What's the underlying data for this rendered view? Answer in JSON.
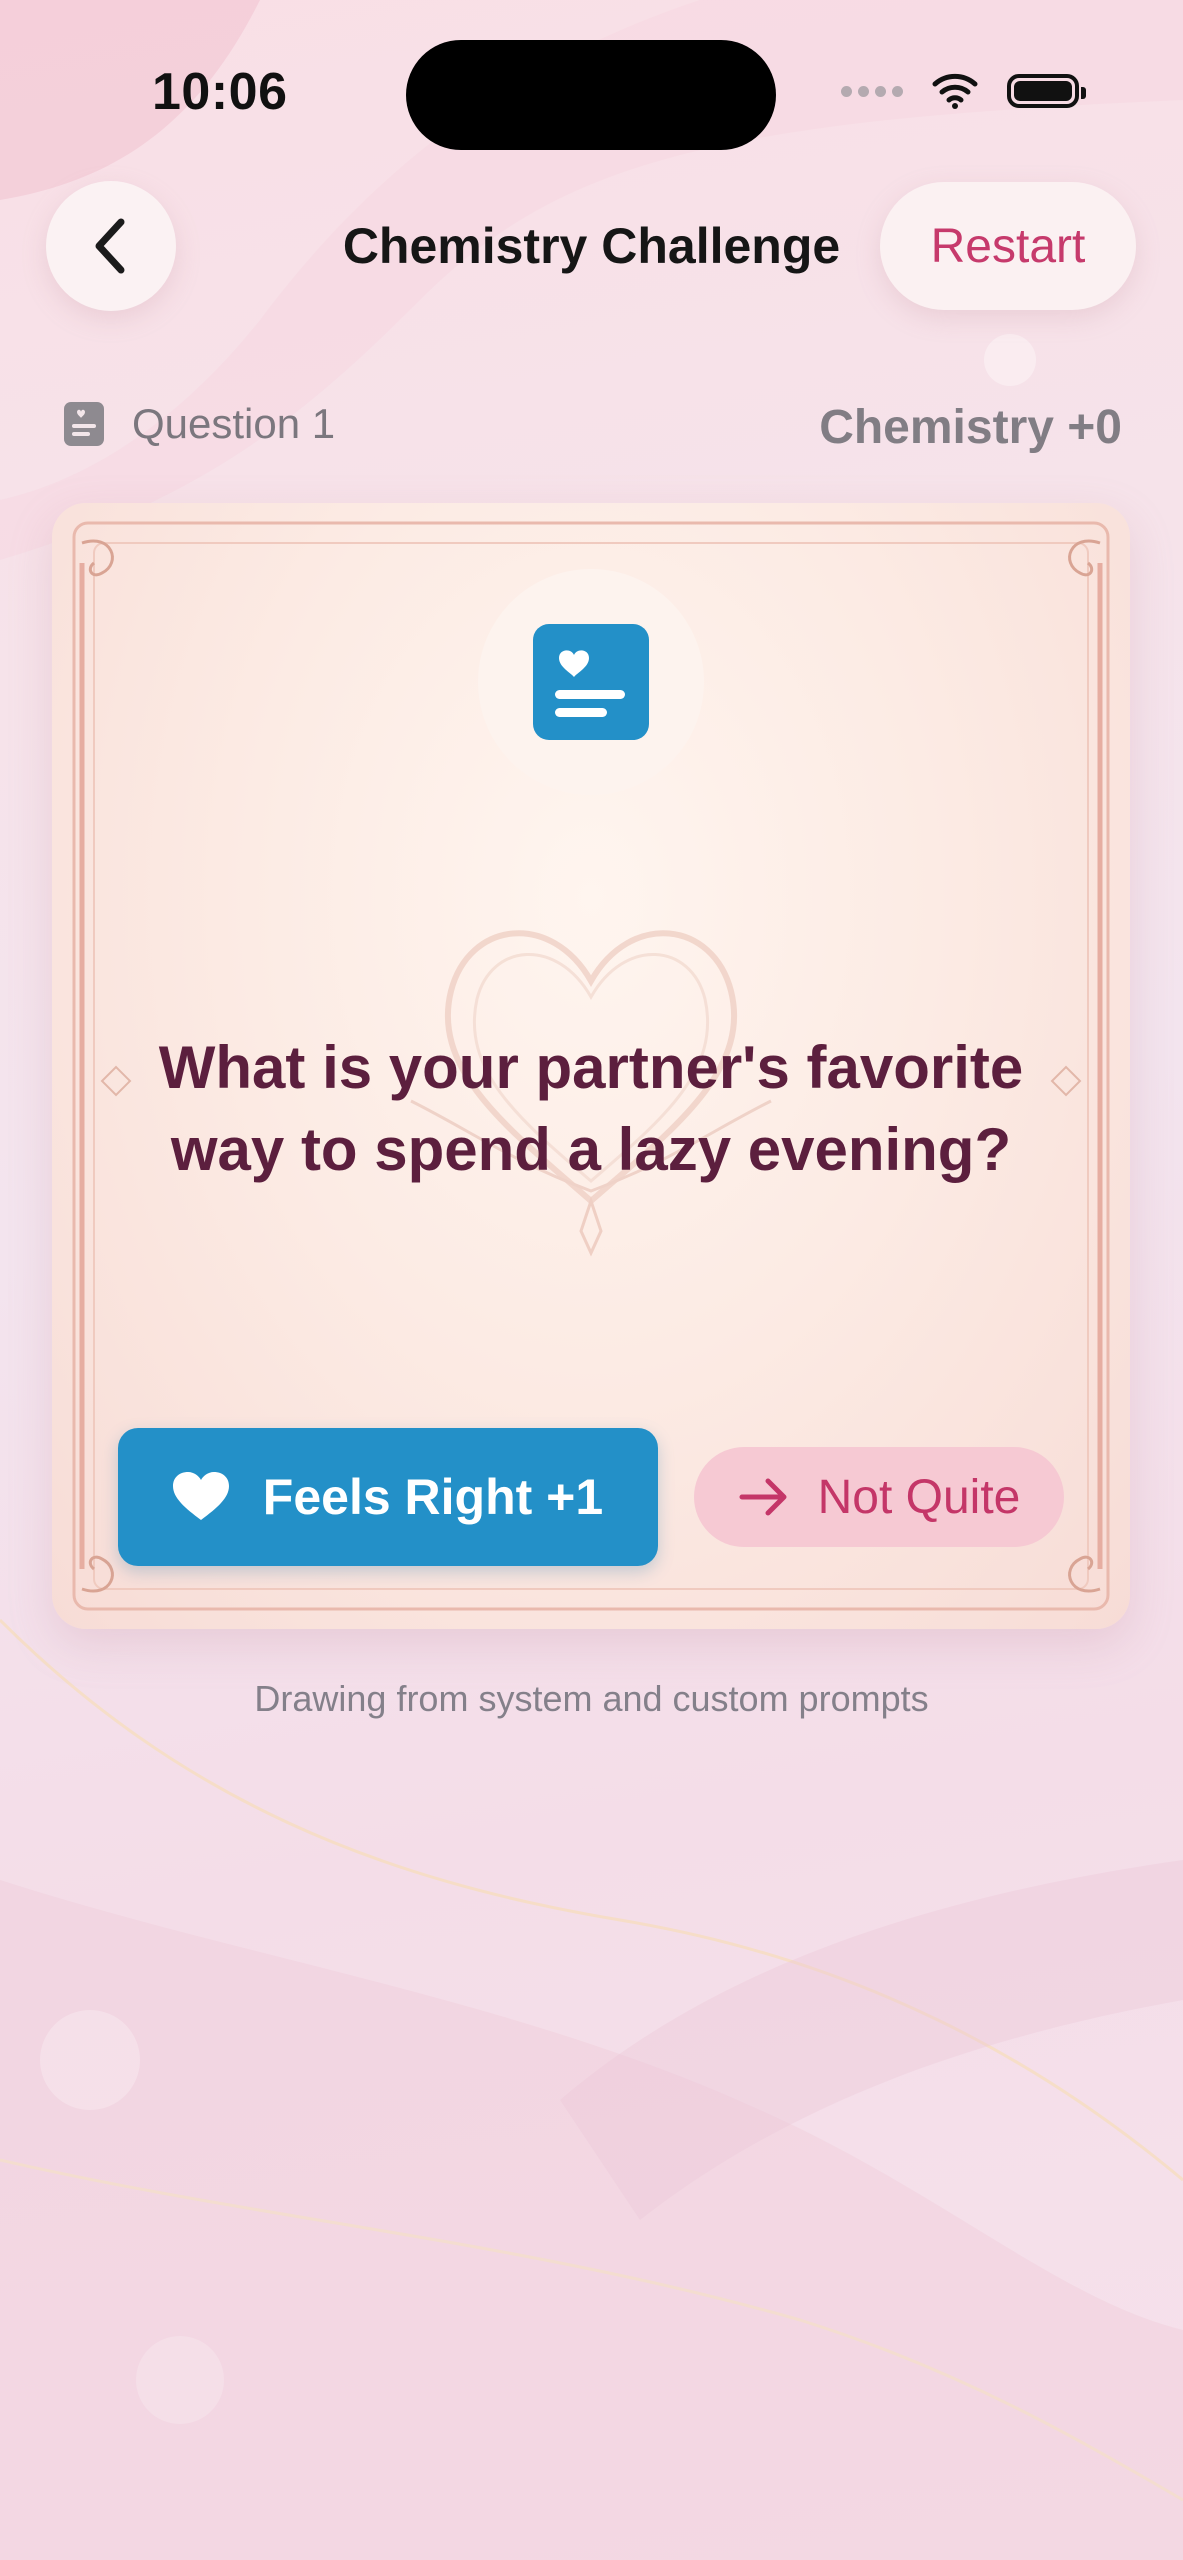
{
  "status_bar": {
    "time": "10:06"
  },
  "nav": {
    "title": "Chemistry Challenge",
    "restart_label": "Restart"
  },
  "meta": {
    "question_label": "Question 1",
    "chemistry_label": "Chemistry +0"
  },
  "card": {
    "question": "What is your partner's favorite way to spend a lazy evening?",
    "yes_label": "Feels Right +1",
    "no_label": "Not Quite"
  },
  "footer": {
    "note": "Drawing from system and custom prompts"
  },
  "colors": {
    "accent_blue": "#2390c8",
    "accent_pink": "#c63a6c",
    "question_text": "#5c1f3e",
    "not_quite_bg": "#f6c9d3"
  },
  "icons": [
    "back-chevron-icon",
    "wifi-icon",
    "battery-icon",
    "question-card-icon",
    "heart-icon",
    "arrow-right-icon"
  ]
}
